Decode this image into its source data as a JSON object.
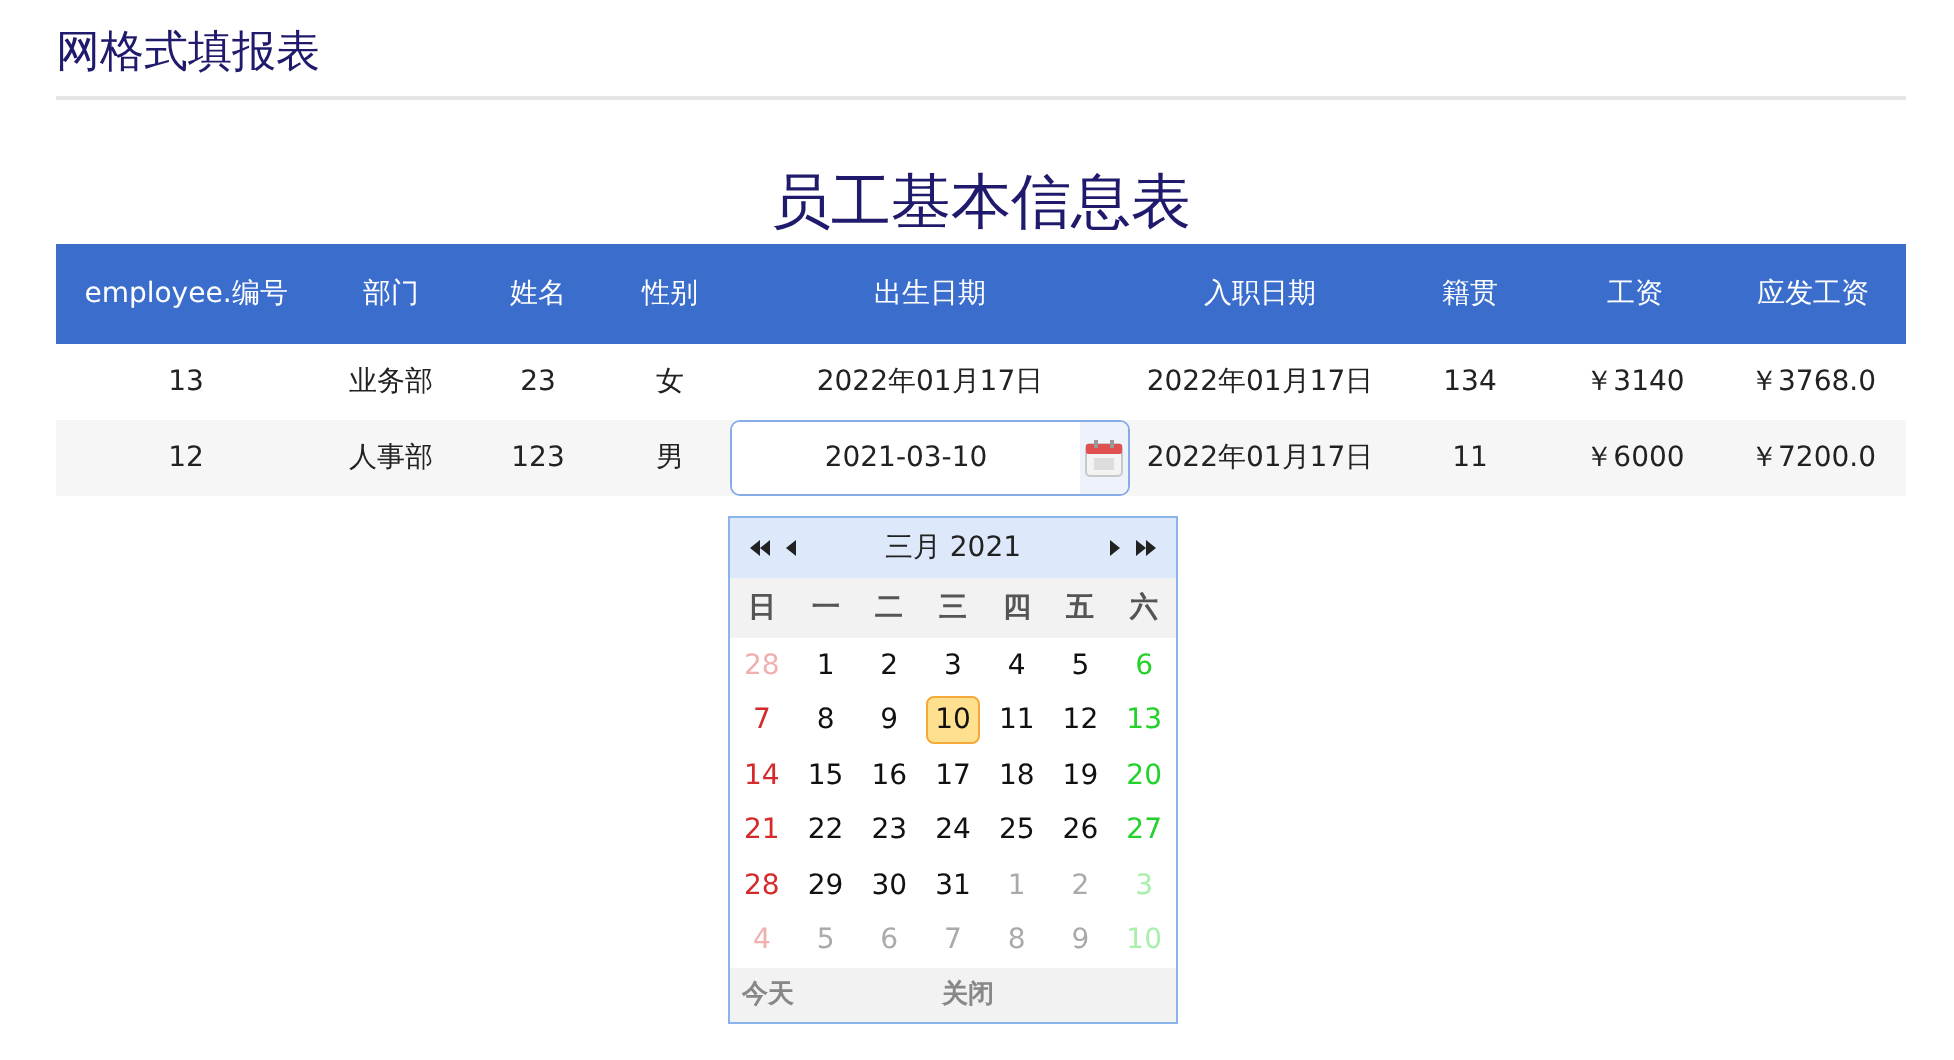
{
  "page_title": "网格式填报表",
  "report_title": "员工基本信息表",
  "table": {
    "columns": [
      "employee.编号",
      "部门",
      "姓名",
      "性别",
      "出生日期",
      "入职日期",
      "籍贯",
      "工资",
      "应发工资"
    ],
    "rows": [
      {
        "cells": [
          {
            "kind": "text",
            "text": "13"
          },
          {
            "kind": "text",
            "text": "业务部"
          },
          {
            "kind": "text",
            "text": "23"
          },
          {
            "kind": "text",
            "text": "女"
          },
          {
            "kind": "text",
            "text": "2022年01月17日"
          },
          {
            "kind": "text",
            "text": "2022年01月17日"
          },
          {
            "kind": "text",
            "text": "134"
          },
          {
            "kind": "text",
            "text": "￥3140"
          },
          {
            "kind": "text",
            "text": "￥3768.0"
          }
        ]
      },
      {
        "cells": [
          {
            "kind": "text",
            "text": "12"
          },
          {
            "kind": "text",
            "text": "人事部"
          },
          {
            "kind": "text",
            "text": "123"
          },
          {
            "kind": "text",
            "text": "男"
          },
          {
            "kind": "editor",
            "value": "2021-03-10"
          },
          {
            "kind": "text",
            "text": "2022年01月17日"
          },
          {
            "kind": "text",
            "text": "11"
          },
          {
            "kind": "text",
            "text": "￥6000"
          },
          {
            "kind": "text",
            "text": "￥7200.0"
          }
        ]
      }
    ]
  },
  "calendar": {
    "title": "三月 2021",
    "weekdays": [
      "日",
      "一",
      "二",
      "三",
      "四",
      "五",
      "六"
    ],
    "weeks": [
      [
        {
          "day": "28",
          "other_month": true,
          "selected": false
        },
        {
          "day": "1",
          "other_month": false,
          "selected": false
        },
        {
          "day": "2",
          "other_month": false,
          "selected": false
        },
        {
          "day": "3",
          "other_month": false,
          "selected": false
        },
        {
          "day": "4",
          "other_month": false,
          "selected": false
        },
        {
          "day": "5",
          "other_month": false,
          "selected": false
        },
        {
          "day": "6",
          "other_month": false,
          "selected": false
        }
      ],
      [
        {
          "day": "7",
          "other_month": false,
          "selected": false
        },
        {
          "day": "8",
          "other_month": false,
          "selected": false
        },
        {
          "day": "9",
          "other_month": false,
          "selected": false
        },
        {
          "day": "10",
          "other_month": false,
          "selected": true
        },
        {
          "day": "11",
          "other_month": false,
          "selected": false
        },
        {
          "day": "12",
          "other_month": false,
          "selected": false
        },
        {
          "day": "13",
          "other_month": false,
          "selected": false
        }
      ],
      [
        {
          "day": "14",
          "other_month": false,
          "selected": false
        },
        {
          "day": "15",
          "other_month": false,
          "selected": false
        },
        {
          "day": "16",
          "other_month": false,
          "selected": false
        },
        {
          "day": "17",
          "other_month": false,
          "selected": false
        },
        {
          "day": "18",
          "other_month": false,
          "selected": false
        },
        {
          "day": "19",
          "other_month": false,
          "selected": false
        },
        {
          "day": "20",
          "other_month": false,
          "selected": false
        }
      ],
      [
        {
          "day": "21",
          "other_month": false,
          "selected": false
        },
        {
          "day": "22",
          "other_month": false,
          "selected": false
        },
        {
          "day": "23",
          "other_month": false,
          "selected": false
        },
        {
          "day": "24",
          "other_month": false,
          "selected": false
        },
        {
          "day": "25",
          "other_month": false,
          "selected": false
        },
        {
          "day": "26",
          "other_month": false,
          "selected": false
        },
        {
          "day": "27",
          "other_month": false,
          "selected": false
        }
      ],
      [
        {
          "day": "28",
          "other_month": false,
          "selected": false
        },
        {
          "day": "29",
          "other_month": false,
          "selected": false
        },
        {
          "day": "30",
          "other_month": false,
          "selected": false
        },
        {
          "day": "31",
          "other_month": false,
          "selected": false
        },
        {
          "day": "1",
          "other_month": true,
          "selected": false
        },
        {
          "day": "2",
          "other_month": true,
          "selected": false
        },
        {
          "day": "3",
          "other_month": true,
          "selected": false
        }
      ],
      [
        {
          "day": "4",
          "other_month": true,
          "selected": false
        },
        {
          "day": "5",
          "other_month": true,
          "selected": false
        },
        {
          "day": "6",
          "other_month": true,
          "selected": false
        },
        {
          "day": "7",
          "other_month": true,
          "selected": false
        },
        {
          "day": "8",
          "other_month": true,
          "selected": false
        },
        {
          "day": "9",
          "other_month": true,
          "selected": false
        },
        {
          "day": "10",
          "other_month": true,
          "selected": false
        }
      ]
    ],
    "footer": [
      "今天",
      "关闭"
    ]
  }
}
